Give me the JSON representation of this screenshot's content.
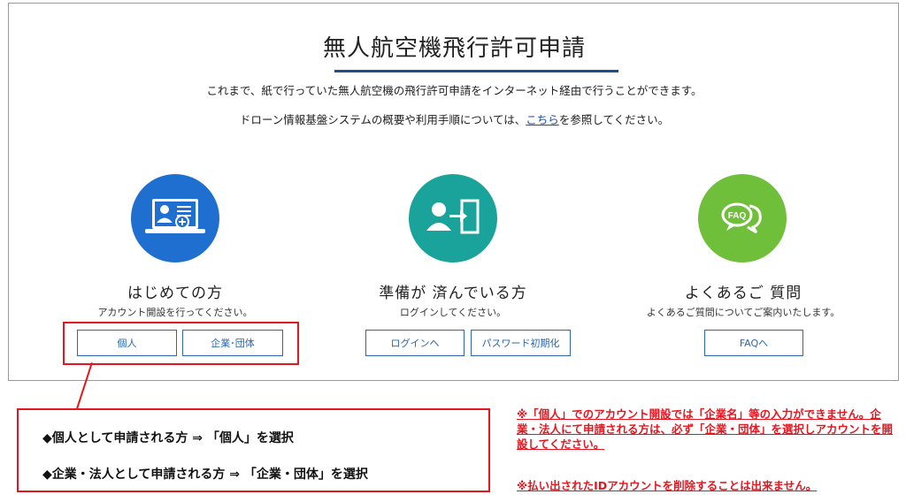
{
  "page": {
    "title": "無人航空機飛行許可申請",
    "lead_line1": "これまで、紙で行っていた無人航空機の飛行許可申請をインターネット経由で行うことができます。",
    "lead_line2_before": "ドローン情報基盤システムの概要や利用手順については、",
    "lead_line2_link": "こちら",
    "lead_line2_after": "を参照してください。"
  },
  "sections": {
    "first_time": {
      "icon": "computer-user-add-icon",
      "color": "#1f6fd0",
      "heading": "はじめての方",
      "sub": "アカウント開設を行ってください。",
      "btn_individual": "個人",
      "btn_corporate": "企業･団体"
    },
    "ready": {
      "icon": "user-login-door-icon",
      "color": "#1aa39a",
      "heading": "準備が 済んでいる方",
      "sub": "ログインしてください。",
      "btn_login": "ログインへ",
      "btn_password": "パスワード初期化"
    },
    "faq": {
      "icon": "faq-speech-bubble-icon",
      "color": "#6fbf3a",
      "heading": "よくあるご 質問",
      "sub": "よくあるご質問についてご案内いたします。",
      "btn_faq": "FAQへ"
    }
  },
  "annotation": {
    "select_individual": "◆個人として申請される方 ⇒ 「個人」を選択",
    "select_corporate": "◆企業・法人として申請される方 ⇒ 「企業・団体」を選択",
    "note1": "※「個人」でのアカウント開設では「企業名」等の入力ができません。企業・法人にて申請される方は、必ず「企業・団体」を選択しアカウントを開設してください。",
    "note2": "※払い出されたIDアカウントを削除することは出来ません。",
    "highlight_color": "#e4161f"
  }
}
